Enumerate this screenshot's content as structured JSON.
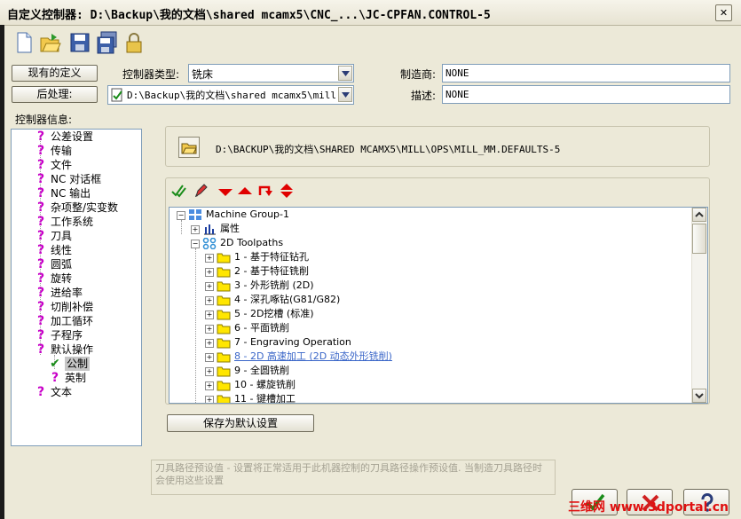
{
  "window": {
    "title": "自定义控制器: D:\\Backup\\我的文档\\shared mcamx5\\CNC_...\\JC-CPFAN.CONTROL-5",
    "close_label": "✕"
  },
  "top": {
    "existing_def_button": "现有的定义",
    "post_button": "后处理:",
    "controller_type_label": "控制器类型:",
    "controller_type_value": "铣床",
    "post_path_value": "D:\\Backup\\我的文档\\shared mcamx5\\mill\\po",
    "manufacturer_label": "制造商:",
    "manufacturer_value": "NONE",
    "description_label": "描述:",
    "description_value": "NONE"
  },
  "left": {
    "header": "控制器信息:",
    "items": [
      {
        "label": "公差设置",
        "icon": "question"
      },
      {
        "label": "传输",
        "icon": "question"
      },
      {
        "label": "文件",
        "icon": "question"
      },
      {
        "label": "NC 对话框",
        "icon": "question"
      },
      {
        "label": "NC 输出",
        "icon": "question"
      },
      {
        "label": "杂项整/实变数",
        "icon": "question"
      },
      {
        "label": "工作系统",
        "icon": "question"
      },
      {
        "label": "刀具",
        "icon": "question"
      },
      {
        "label": "线性",
        "icon": "question"
      },
      {
        "label": "圆弧",
        "icon": "question"
      },
      {
        "label": "旋转",
        "icon": "question"
      },
      {
        "label": "进给率",
        "icon": "question"
      },
      {
        "label": "切削补偿",
        "icon": "question"
      },
      {
        "label": "加工循环",
        "icon": "question"
      },
      {
        "label": "子程序",
        "icon": "question"
      },
      {
        "label": "默认操作",
        "icon": "question"
      },
      {
        "label": "公制",
        "icon": "check"
      },
      {
        "label": "英制",
        "icon": "question"
      },
      {
        "label": "文本",
        "icon": "question"
      }
    ]
  },
  "defaults": {
    "path": "D:\\BACKUP\\我的文档\\SHARED MCAMX5\\MILL\\OPS\\MILL_MM.DEFAULTS-5"
  },
  "ops": {
    "root": "Machine Group-1",
    "properties": "属性",
    "group": "2D Toolpaths",
    "items": [
      "1 - 基于特征钻孔",
      "2 - 基于特征铣削",
      "3 - 外形铣削 (2D)",
      "4 - 深孔啄钻(G81/G82)",
      "5 - 2D挖槽 (标准)",
      "6 - 平面铣削",
      "7 - Engraving Operation",
      "8 - 2D 高速加工 (2D 动态外形铣削)",
      "9 - 全圆铣削",
      "10 - 螺旋铣削",
      "11 - 键槽加工"
    ],
    "save_default_button": "保存为默认设置"
  },
  "hint": {
    "text": "刀具路径预设值 - 设置将正常适用于此机器控制的刀具路径操作预设值. 当制造刀具路径时会使用这些设置"
  },
  "watermark": "三维网 www.3dportal.cn",
  "colors": {
    "question": "#c800c8",
    "check": "#1a8c1a",
    "down_red": "#e00000",
    "link_blue": "#3a66c8"
  }
}
